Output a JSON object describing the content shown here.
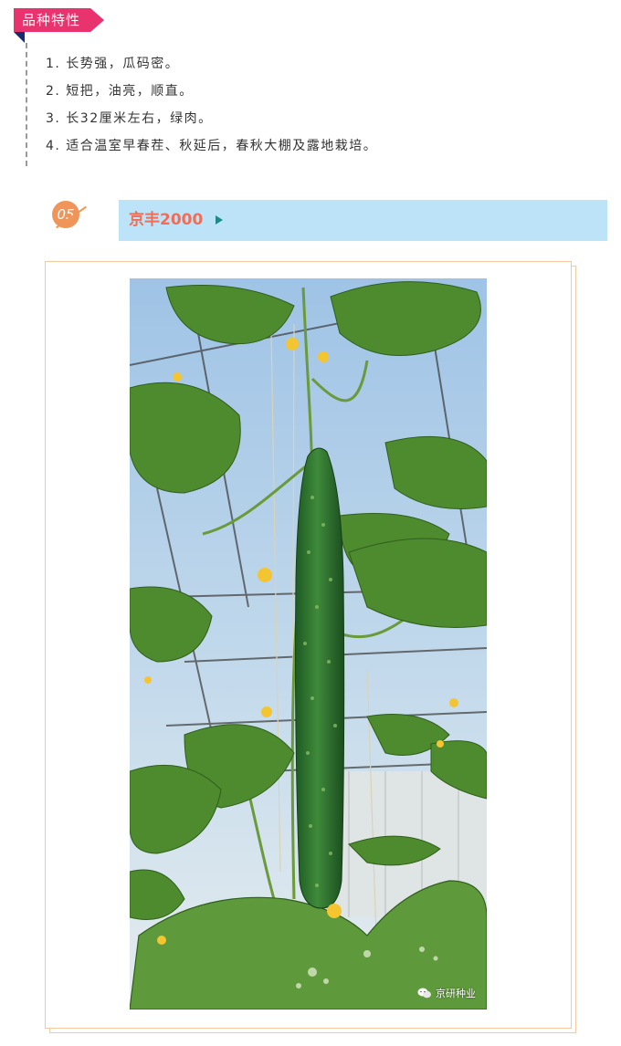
{
  "section_tag": "品种特性",
  "features": [
    "1. 长势强，瓜码密。",
    "2. 短把，油亮，顺直。",
    "3. 长32厘米左右，绿肉。",
    "4. 适合温室早春茬、秋延后，春秋大棚及露地栽培。"
  ],
  "variety": {
    "number": "05",
    "name": "京丰2000"
  },
  "photo": {
    "watermark": "京研种业",
    "watermark_icon": "wechat-icon"
  },
  "colors": {
    "tag": "#e8336e",
    "title_bar": "#bde3f8",
    "title_text": "#ee6e5a",
    "number_circle": "#f0955a",
    "frame_border": "#f2c9a0"
  }
}
